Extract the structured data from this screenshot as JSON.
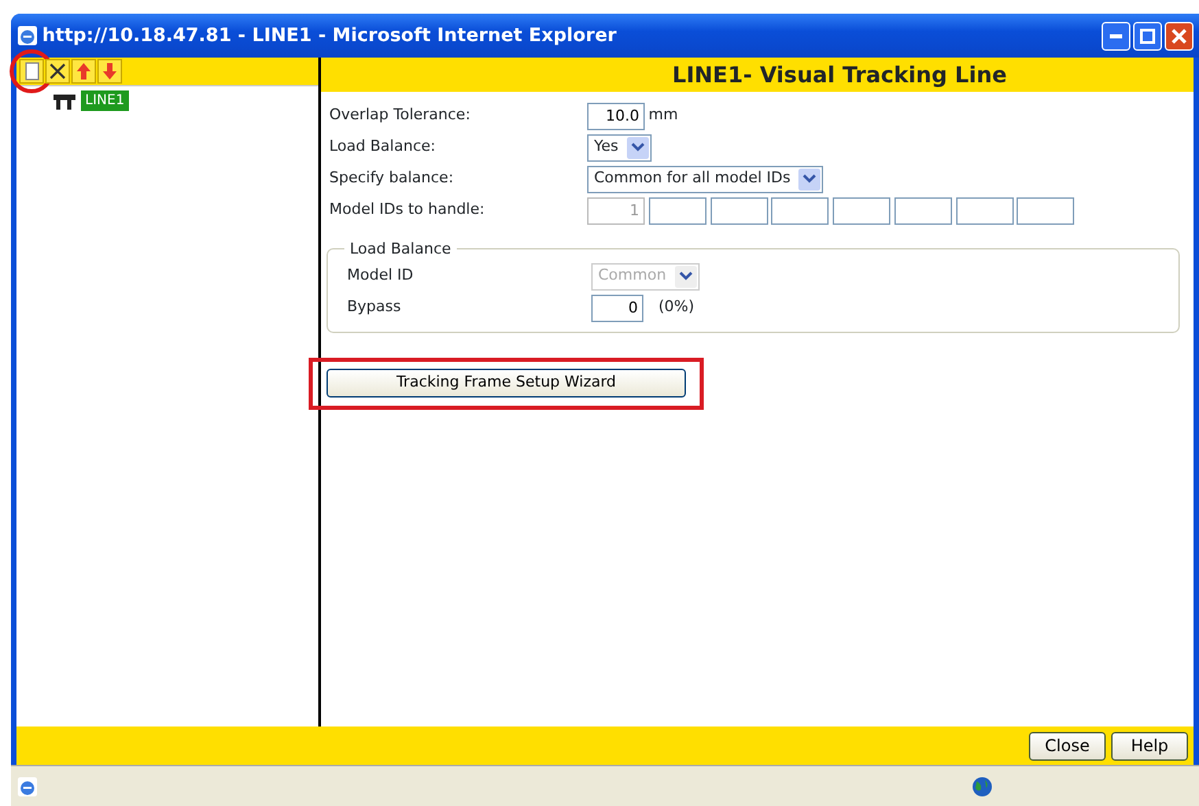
{
  "window": {
    "title": "http://10.18.47.81 - LINE1 - Microsoft Internet Explorer"
  },
  "toolbar": [
    {
      "kind": "new",
      "highlighted": true
    },
    {
      "kind": "delete",
      "highlighted": false
    },
    {
      "kind": "up",
      "highlighted": false
    },
    {
      "kind": "down",
      "highlighted": false
    }
  ],
  "tree": [
    {
      "label": "LINE1",
      "selected": true
    }
  ],
  "header": "LINE1- Visual Tracking Line",
  "fields": [
    {
      "kind": "number",
      "label": "Overlap Tolerance:",
      "value": "10.0",
      "unit": "mm"
    },
    {
      "kind": "select",
      "label": "Load Balance:",
      "value": "Yes",
      "disabled": false
    },
    {
      "kind": "select",
      "label": "Specify balance:",
      "value": "Common for all model IDs",
      "disabled": false
    },
    {
      "kind": "id_list",
      "label": "Model IDs to handle:",
      "boxes": [
        {
          "value": "1",
          "disabled": true
        },
        {
          "disabled": false
        },
        {
          "disabled": false
        },
        {
          "disabled": false
        },
        {
          "disabled": false
        },
        {
          "disabled": false
        },
        {
          "disabled": false
        },
        {
          "disabled": false
        }
      ]
    }
  ],
  "load_balance_group": {
    "legend": "Load Balance",
    "fields": [
      {
        "kind": "select",
        "label": "Model ID",
        "value": "Common",
        "disabled": true
      },
      {
        "kind": "number",
        "label": "Bypass",
        "value": "0",
        "unit": "(0%)"
      }
    ]
  },
  "wizard_button": {
    "label": "Tracking Frame Setup Wizard",
    "highlighted": true
  },
  "footer_buttons": [
    "Close",
    "Help"
  ]
}
